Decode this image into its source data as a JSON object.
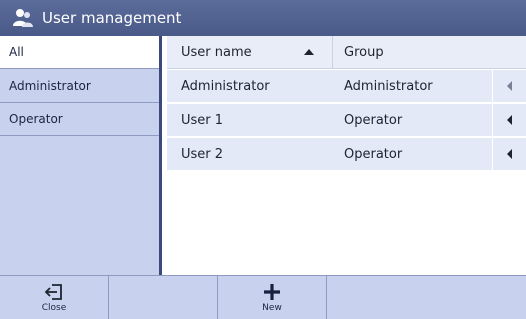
{
  "window": {
    "title": "User management",
    "icon": "users-icon"
  },
  "sidebar": {
    "items": [
      {
        "label": "All",
        "selected": true
      },
      {
        "label": "Administrator",
        "selected": false
      },
      {
        "label": "Operator",
        "selected": false
      }
    ]
  },
  "table": {
    "columns": [
      {
        "label": "User name",
        "sort": "ascending"
      },
      {
        "label": "Group"
      }
    ],
    "rows": [
      {
        "user": "Administrator",
        "group": "Administrator"
      },
      {
        "user": "User 1",
        "group": "Operator"
      },
      {
        "user": "User 2",
        "group": "Operator"
      }
    ]
  },
  "toolbar": {
    "close_label": "Close",
    "new_label": "New"
  },
  "colors": {
    "titlebar": "#4a5a88",
    "sidebar": "#c8d2ee",
    "row": "#e3e9f7"
  }
}
